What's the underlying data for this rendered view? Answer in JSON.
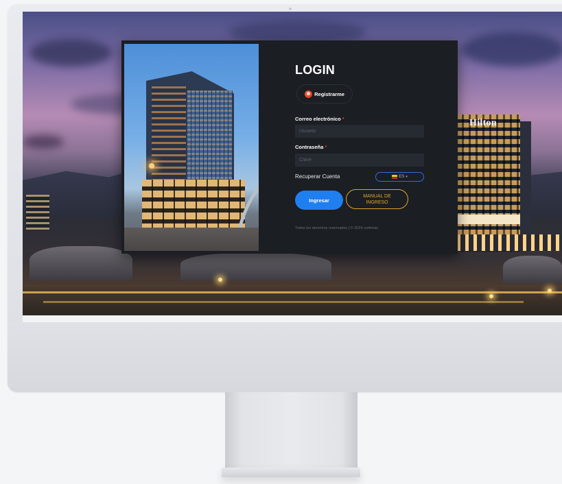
{
  "background": {
    "hotel_sign": "Hilton"
  },
  "login": {
    "title": "LOGIN",
    "register_label": "Registrarme",
    "email": {
      "label": "Correo electrónico",
      "required_mark": "*",
      "placeholder": "Usuario",
      "value": ""
    },
    "password": {
      "label": "Contraseña",
      "required_mark": "*",
      "placeholder": "Clave",
      "value": ""
    },
    "recover_label": "Recuperar Cuenta",
    "language": {
      "selected": "ES",
      "flag_icon": "colombia-flag-icon"
    },
    "submit_label": "Ingresar",
    "manual_label_line1": "MANUAL DE",
    "manual_label_line2": "INGRESO",
    "footer": "Todos los derechos reservados | © 2024 corferias"
  },
  "colors": {
    "primary_button": "#1f7ff0",
    "manual_button": "#e4a52a",
    "required": "#e23b3b",
    "card_background": "#1b1e23"
  }
}
